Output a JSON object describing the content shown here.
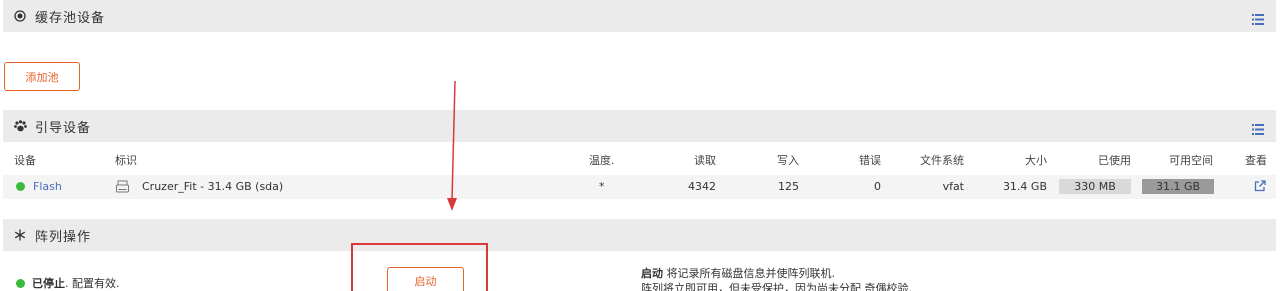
{
  "cache": {
    "title": "缓存池设备",
    "add_pool": "添加池",
    "icon": "target-icon"
  },
  "boot": {
    "title": "引导设备",
    "icon": "paw-icon",
    "headers": [
      "设备",
      "标识",
      "温度.",
      "读取",
      "写入",
      "错误",
      "文件系统",
      "大小",
      "已使用",
      "可用空间",
      "查看"
    ],
    "row": {
      "status": "green",
      "device": "Flash",
      "identification": "Cruzer_Fit - 31.4 GB (sda)",
      "temp": "*",
      "reads": "4342",
      "writes": "125",
      "errors": "0",
      "fs": "vfat",
      "size": "31.4 GB",
      "used": "330 MB",
      "free": "31.1 GB",
      "view_icon": "external-link-icon"
    }
  },
  "array": {
    "title": "阵列操作",
    "icon": "snowflake-icon",
    "status_label": "已停止",
    "status_suffix": ". 配置有效.",
    "start_button": "启动",
    "desc_bold": "启动",
    "desc_line1": " 将记录所有磁盘信息并使阵列联机.",
    "desc_line2": "阵列将立即可用，但未受保护，因为尚未分配 奇偶校验."
  },
  "colors": {
    "accent": "#e8622a",
    "link": "#486dba",
    "ok": "#3cba3c",
    "annotation": "#d83a3a"
  }
}
